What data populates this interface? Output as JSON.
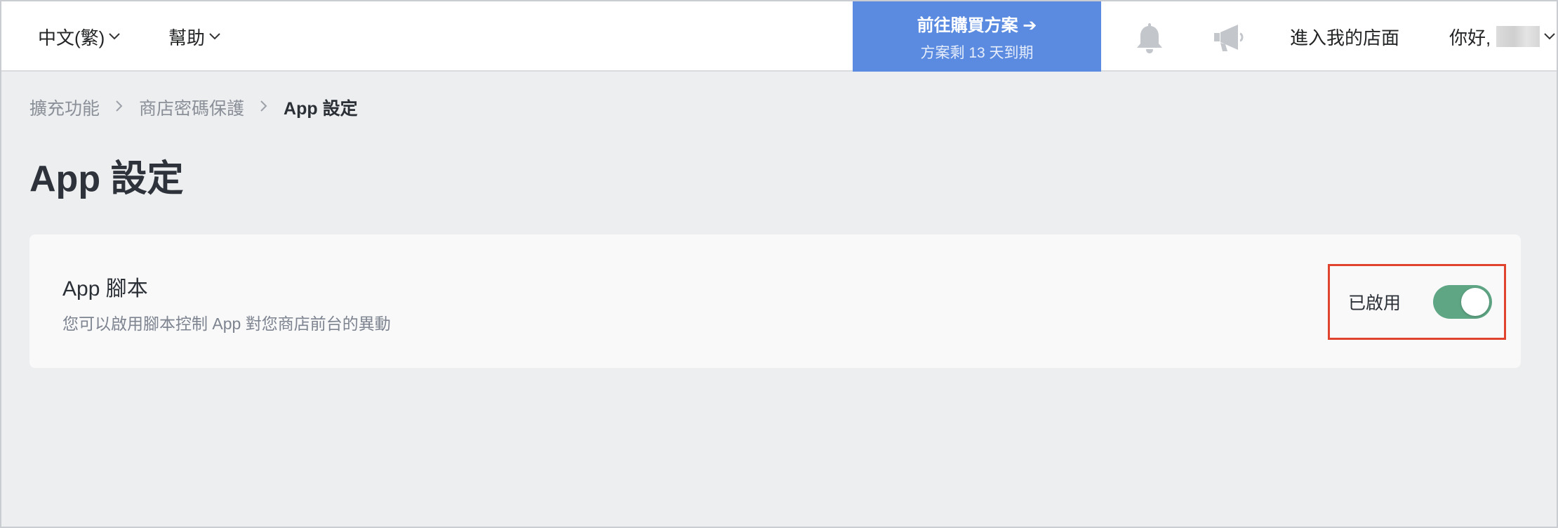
{
  "topbar": {
    "language": "中文(繁)",
    "help": "幫助",
    "promo_title": "前往購買方案 ➔",
    "promo_subtitle": "方案剩 13 天到期",
    "store_link": "進入我的店面",
    "greeting": "你好,"
  },
  "icons": {
    "notification": "bell-icon",
    "announcement": "megaphone-icon"
  },
  "breadcrumb": {
    "items": [
      "擴充功能",
      "商店密碼保護"
    ],
    "current": "App 設定"
  },
  "page": {
    "title": "App 設定"
  },
  "card": {
    "title": "App 腳本",
    "description": "您可以啟用腳本控制 App 對您商店前台的異動",
    "status_label": "已啟用",
    "enabled": true
  },
  "colors": {
    "promo_bg": "#5b8be0",
    "toggle_on": "#5fa685",
    "highlight_border": "#e0442f",
    "page_bg": "#edeef0"
  }
}
